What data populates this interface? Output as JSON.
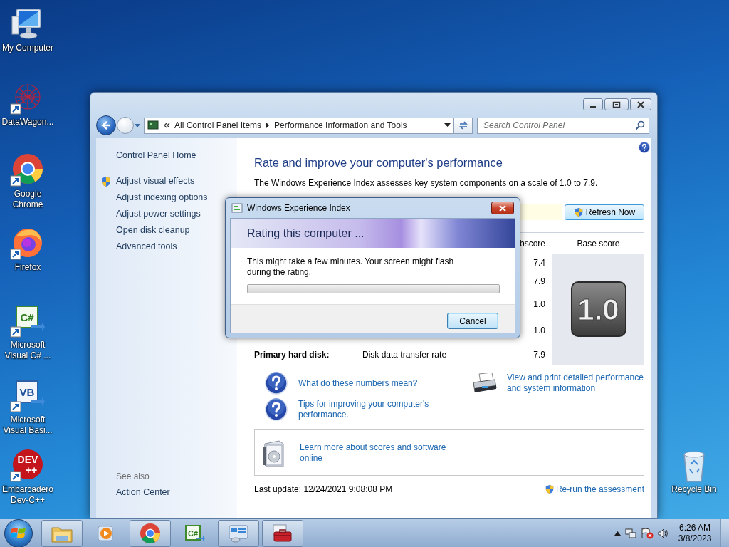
{
  "desktop_icons": [
    {
      "label": "My Computer",
      "kind": "computer",
      "shortcut": false
    },
    {
      "label": "DataWagon...",
      "kind": "network",
      "shortcut": true
    },
    {
      "label": "Google Chrome",
      "kind": "chrome",
      "shortcut": true
    },
    {
      "label": "Firefox",
      "kind": "firefox",
      "shortcut": true
    },
    {
      "label": "Microsoft Visual C# ...",
      "kind": "csharp",
      "glyph": "C#",
      "shortcut": true
    },
    {
      "label": "Microsoft Visual Basi...",
      "kind": "vb",
      "glyph": "VB",
      "shortcut": true
    },
    {
      "label": "Embarcadero Dev-C++",
      "kind": "devcpp",
      "glyph": "DEV",
      "glyph_2": "++",
      "shortcut": true
    }
  ],
  "recycle_bin": {
    "label": "Recycle Bin"
  },
  "window": {
    "address": [
      "All Control Panel Items",
      "Performance Information and Tools"
    ],
    "search": {
      "placeholder": "Search Control Panel"
    },
    "sidebar": {
      "items": [
        {
          "label": "Control Panel Home",
          "kind": "home",
          "shield": false
        },
        {
          "label": "Adjust visual effects",
          "kind": "task",
          "shield": true
        },
        {
          "label": "Adjust indexing options",
          "kind": "task",
          "shield": false
        },
        {
          "label": "Adjust power settings",
          "kind": "task",
          "shield": false
        },
        {
          "label": "Open disk cleanup",
          "kind": "task",
          "shield": false
        },
        {
          "label": "Advanced tools",
          "kind": "task",
          "shield": false
        }
      ],
      "see_also": {
        "title": "See also",
        "items": [
          "Action Center"
        ]
      }
    },
    "heading": "Rate and improve your computer's performance",
    "description": "The Windows Experience Index assesses key system components on a scale of 1.0 to 7.9.",
    "refresh_button": "Refresh Now",
    "table": {
      "columns": [
        "bscore",
        "Base score"
      ],
      "rows": [
        {
          "subscore": "7.4"
        },
        {
          "subscore": "7.9"
        },
        {
          "subscore": "1.0"
        },
        {
          "subscore": "1.0"
        },
        {
          "component": "Primary hard disk:",
          "rated": "Disk data transfer rate",
          "subscore": "7.9"
        }
      ],
      "base_score": "1.0"
    },
    "links": [
      {
        "label": "What do these numbers mean?",
        "kind": "help"
      },
      {
        "label": "Tips for improving your computer's performance.",
        "kind": "help"
      },
      {
        "label": "View and print detailed performance and system information",
        "kind": "printer"
      }
    ],
    "online_link": "Learn more about scores and software online",
    "last_update": "Last update: 12/24/2021 9:08:08 PM",
    "rerun_link": "Re-run the assessment"
  },
  "dialog": {
    "title": "Windows Experience Index",
    "banner": "Rating this computer ...",
    "message": "This might take a few minutes. Your screen might flash during the rating.",
    "progress": {
      "level": 0
    },
    "button": "Cancel"
  },
  "taskbar": {
    "items": [
      {
        "kind": "explorer",
        "running": true
      },
      {
        "kind": "media",
        "running": false
      },
      {
        "kind": "chrome",
        "running": true
      },
      {
        "kind": "csharp",
        "glyph": "C#",
        "running": false
      },
      {
        "kind": "control_panel",
        "running": true
      },
      {
        "kind": "toolbox",
        "running": true
      }
    ],
    "time": "6:26 AM",
    "date": "3/8/2023"
  }
}
